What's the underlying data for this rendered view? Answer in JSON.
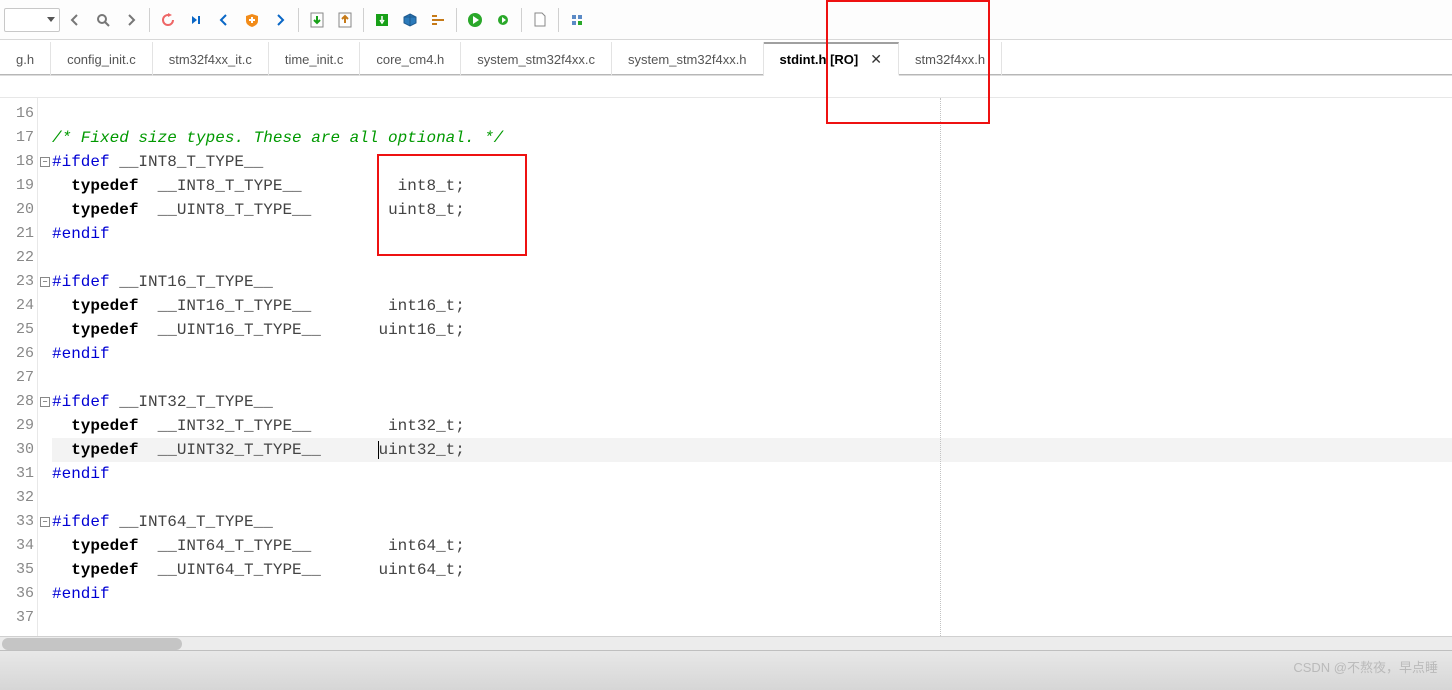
{
  "toolbar": {
    "icons": [
      "dropdown",
      "nav-back",
      "search",
      "nav-fwd",
      "sep",
      "undo-step",
      "step-over",
      "step-in",
      "debug",
      "step-out",
      "download-left",
      "download-right",
      "sep",
      "save",
      "cube",
      "indent",
      "sep",
      "run",
      "run-small",
      "sep",
      "file",
      "sep",
      "db"
    ]
  },
  "tabs": [
    {
      "label": "g.h",
      "active": false
    },
    {
      "label": "config_init.c",
      "active": false
    },
    {
      "label": "stm32f4xx_it.c",
      "active": false
    },
    {
      "label": "time_init.c",
      "active": false
    },
    {
      "label": "core_cm4.h",
      "active": false
    },
    {
      "label": "system_stm32f4xx.c",
      "active": false
    },
    {
      "label": "system_stm32f4xx.h",
      "active": false
    },
    {
      "label": "stdint.h [RO]",
      "active": true,
      "closeable": true
    },
    {
      "label": "stm32f4xx.h",
      "active": false
    }
  ],
  "gutter": {
    "start": 16,
    "end": 37
  },
  "code": {
    "l17": "/* Fixed size types. These are all optional. */",
    "l18_pp": "#ifdef",
    "l18_mac": " __INT8_T_TYPE__",
    "l19_kw": "typedef",
    "l19_mid": "  __INT8_T_TYPE__          int8_t;",
    "l20_kw": "typedef",
    "l20_mid": "  __UINT8_T_TYPE__        uint8_t;",
    "l21": "#endif",
    "l23_pp": "#ifdef",
    "l23_mac": " __INT16_T_TYPE__",
    "l24_kw": "typedef",
    "l24_mid": "  __INT16_T_TYPE__        int16_t;",
    "l25_kw": "typedef",
    "l25_mid": "  __UINT16_T_TYPE__      uint16_t;",
    "l26": "#endif",
    "l28_pp": "#ifdef",
    "l28_mac": " __INT32_T_TYPE__",
    "l29_kw": "typedef",
    "l29_mid": "  __INT32_T_TYPE__        int32_t;",
    "l30_kw": "typedef",
    "l30_mid_a": "  __UINT32_T_TYPE__      ",
    "l30_mid_b": "uint32_t;",
    "l31": "#endif",
    "l33_pp": "#ifdef",
    "l33_mac": " __INT64_T_TYPE__",
    "l34_kw": "typedef",
    "l34_mid": "  __INT64_T_TYPE__        int64_t;",
    "l35_kw": "typedef",
    "l35_mid": "  __UINT64_T_TYPE__      uint64_t;",
    "l36": "#endif"
  },
  "watermark": "CSDN @不熬夜，早点睡"
}
